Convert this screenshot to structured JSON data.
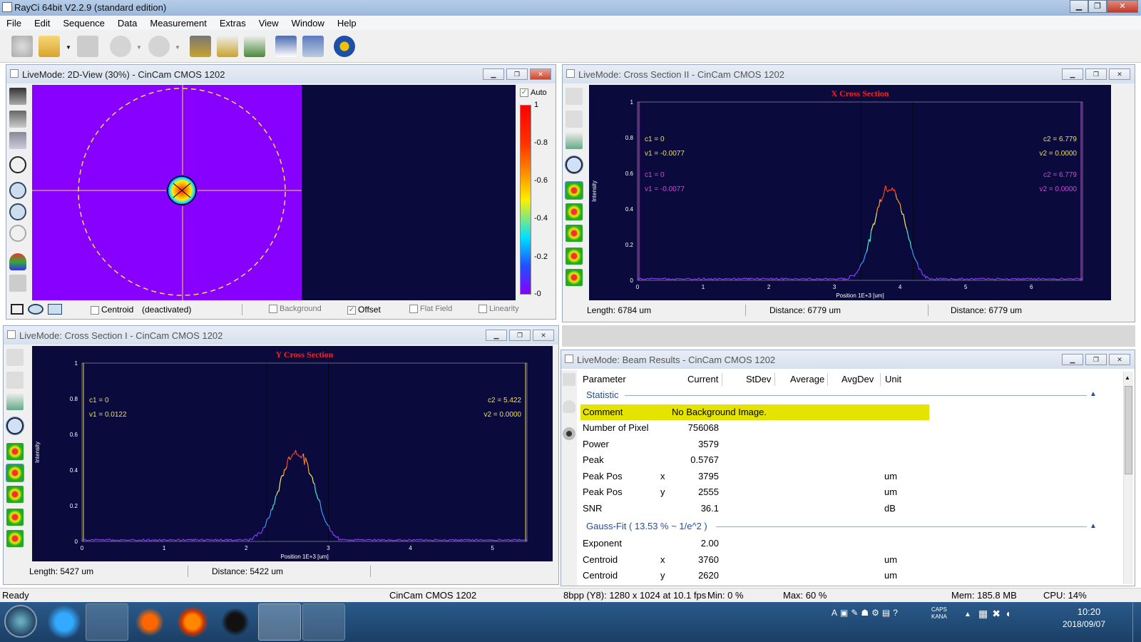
{
  "app": {
    "title": "RayCi 64bit V2.2.9 (standard edition)",
    "menu": [
      "File",
      "Edit",
      "Sequence",
      "Data",
      "Measurement",
      "Extras",
      "View",
      "Window",
      "Help"
    ]
  },
  "win2d": {
    "title": "LiveMode: 2D-View (30%) - CinCam CMOS 1202",
    "auto_label": "Auto",
    "scale_ticks": [
      "1",
      "0.8",
      "0.6",
      "0.4",
      "0.2",
      "0"
    ],
    "centroid_label": "Centroid",
    "deactivated": "(deactivated)",
    "background_label": "Background",
    "offset_label": "Offset",
    "flatfield_label": "Flat Field",
    "linearity_label": "Linearity"
  },
  "cs2": {
    "title": "LiveMode: Cross Section II - CinCam CMOS 1202",
    "chart_title": "X Cross Section",
    "ylabel": "Intensity",
    "xlabel": "Position 1E+3 [um]",
    "yticks": [
      "1",
      "0.8",
      "0.6",
      "0.4",
      "0.2",
      "0"
    ],
    "xticks": [
      "0",
      "1",
      "2",
      "3",
      "4",
      "5",
      "6"
    ],
    "c1a": "c1 = 0",
    "v1a": "v1 = -0.0077",
    "c2a": "c2 = 6.779",
    "v2a": "v2 = 0.0000",
    "c1b": "c1 = 0",
    "v1b": "v1 = -0.0077",
    "c2b": "c2 = 6.779",
    "v2b": "v2 = 0.0000",
    "length": "Length:  6784 um",
    "distance1": "Distance: 6779 um",
    "distance2": "Distance: 6779 um"
  },
  "cs1": {
    "title": "LiveMode: Cross Section I - CinCam CMOS 1202",
    "chart_title": "Y Cross Section",
    "ylabel": "Intensity",
    "xlabel": "Position 1E+3 [um]",
    "yticks": [
      "1",
      "0.8",
      "0.6",
      "0.4",
      "0.2",
      "0"
    ],
    "xticks": [
      "0",
      "1",
      "2",
      "3",
      "4",
      "5"
    ],
    "c1": "c1 = 0",
    "v1": "v1 = 0.0122",
    "c2": "c2 = 5.422",
    "v2": "v2 = 0.0000",
    "length": "Length:  5427 um",
    "distance": "Distance: 5422 um"
  },
  "results": {
    "title": "LiveMode: Beam Results - CinCam CMOS 1202",
    "headers": [
      "Parameter",
      "Current",
      "StDev",
      "Average",
      "AvgDev",
      "Unit"
    ],
    "section1": "Statistic",
    "comment_label": "Comment",
    "comment_value": "No Background Image.",
    "rows1": [
      {
        "p": "Number of Pixel",
        "a": "",
        "v": "756068",
        "u": ""
      },
      {
        "p": "Power",
        "a": "",
        "v": "3579",
        "u": ""
      },
      {
        "p": "Peak",
        "a": "",
        "v": "0.5767",
        "u": ""
      },
      {
        "p": "Peak Pos",
        "a": "x",
        "v": "3795",
        "u": "um"
      },
      {
        "p": "Peak Pos",
        "a": "y",
        "v": "2555",
        "u": "um"
      },
      {
        "p": "SNR",
        "a": "",
        "v": "36.1",
        "u": "dB"
      }
    ],
    "section2": "Gauss-Fit ( 13.53 % ~ 1/e^2 )",
    "rows2": [
      {
        "p": "Exponent",
        "a": "",
        "v": "2.00",
        "u": ""
      },
      {
        "p": "Centroid",
        "a": "x",
        "v": "3760",
        "u": "um"
      },
      {
        "p": "Centroid",
        "a": "y",
        "v": "2620",
        "u": "um"
      }
    ]
  },
  "status": {
    "ready": "Ready",
    "camera": "CinCam CMOS 1202",
    "format": "8bpp (Y8): 1280 x 1024 at 10.1 fps",
    "min": "Min:    0 %",
    "max": "Max:   60 %",
    "mem": "Mem: 185.8 MB",
    "cpu": "CPU: 14%"
  },
  "taskbar": {
    "time": "10:20",
    "date": "2018/09/07",
    "caps": "CAPS",
    "kana": "KANA"
  },
  "colors": {
    "plot_bg": "#0a0a3c",
    "view_bg": "#8800ff",
    "cursor": "#f0e040",
    "title_red": "#ff2020",
    "magenta": "#e040e0",
    "highlight": "#e4e400"
  }
}
